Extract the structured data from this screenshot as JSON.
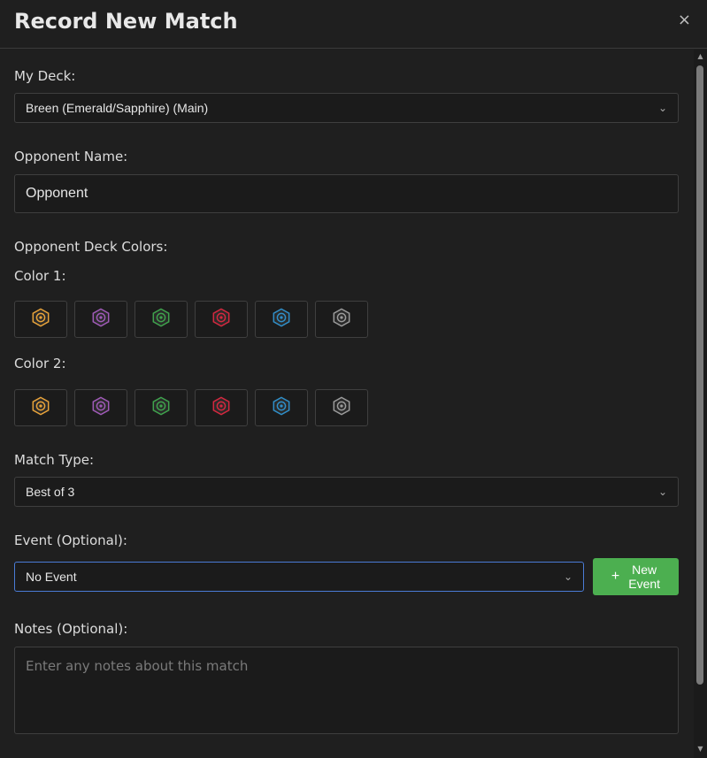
{
  "dialog": {
    "title": "Record New Match",
    "close_glyph": "×"
  },
  "my_deck": {
    "label": "My Deck:",
    "selected": "Breen (Emerald/Sapphire) (Main)"
  },
  "opponent_name": {
    "label": "Opponent Name:",
    "value": "Opponent"
  },
  "opponent_colors": {
    "label": "Opponent Deck Colors:",
    "color1_label": "Color 1:",
    "color2_label": "Color 2:",
    "options": [
      {
        "icon": "amber-icon",
        "color": "#e8a33a"
      },
      {
        "icon": "amethyst-icon",
        "color": "#a05ab8"
      },
      {
        "icon": "emerald-icon",
        "color": "#3fa34d"
      },
      {
        "icon": "ruby-icon",
        "color": "#d5283f"
      },
      {
        "icon": "sapphire-icon",
        "color": "#2f8fc9"
      },
      {
        "icon": "steel-icon",
        "color": "#9b9b9b"
      }
    ]
  },
  "match_type": {
    "label": "Match Type:",
    "selected": "Best of 3"
  },
  "event": {
    "label": "Event (Optional):",
    "selected": "No Event",
    "new_button_plus": "+",
    "new_button_line1": "New",
    "new_button_line2": "Event",
    "accent": "#4caf50",
    "focus_border": "#4a7bd6"
  },
  "notes": {
    "label": "Notes (Optional):",
    "placeholder": "Enter any notes about this match"
  }
}
